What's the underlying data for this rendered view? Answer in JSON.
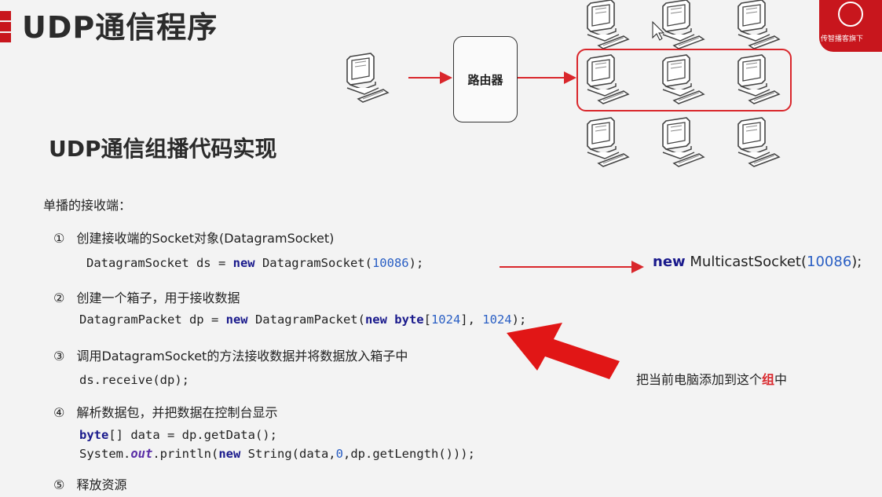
{
  "title": "UDP通信程序",
  "subtitle": "UDP通信组播代码实现",
  "router_label": "路由器",
  "logo_text": "传智播客旗下",
  "intro": "单播的接收端：",
  "steps": [
    {
      "num": "①",
      "text": "创建接收端的Socket对象(DatagramSocket)"
    },
    {
      "num": "②",
      "text": "创建一个箱子，用于接收数据"
    },
    {
      "num": "③",
      "text": "调用DatagramSocket的方法接收数据并将数据放入箱子中"
    },
    {
      "num": "④",
      "text": "解析数据包，并把数据在控制台显示"
    },
    {
      "num": "⑤",
      "text": "释放资源"
    }
  ],
  "code": {
    "line1": {
      "a": "DatagramSocket ds = ",
      "kw": "new",
      "b": " DatagramSocket(",
      "n": "10086",
      "c": ");"
    },
    "line2": {
      "a": "DatagramPacket dp = ",
      "kw1": "new",
      "b": " DatagramPacket(",
      "kw2": "new",
      "sp": " ",
      "kw3": "byte",
      "c": "[",
      "n1": "1024",
      "d": "], ",
      "n2": "1024",
      "e": ");"
    },
    "line3": "ds.receive(dp);",
    "line4": {
      "kw": "byte",
      "a": "[] data = dp.getData();"
    },
    "line5": {
      "a": "System.",
      "f": "out",
      "b": ".println(",
      "kw": "new",
      "c": " String(data,",
      "n": "0",
      "d": ",dp.getLength()));"
    }
  },
  "multicast": {
    "kw": "new",
    "a": " MulticastSocket(",
    "n": "10086",
    "b": ");"
  },
  "note": {
    "a": "把当前电脑添加到这个",
    "red": "组",
    "b": "中"
  },
  "colors": {
    "accent": "#c8161d",
    "arrow": "#d9262b",
    "keyword": "#1a1a8c",
    "number": "#2a5fc4"
  }
}
